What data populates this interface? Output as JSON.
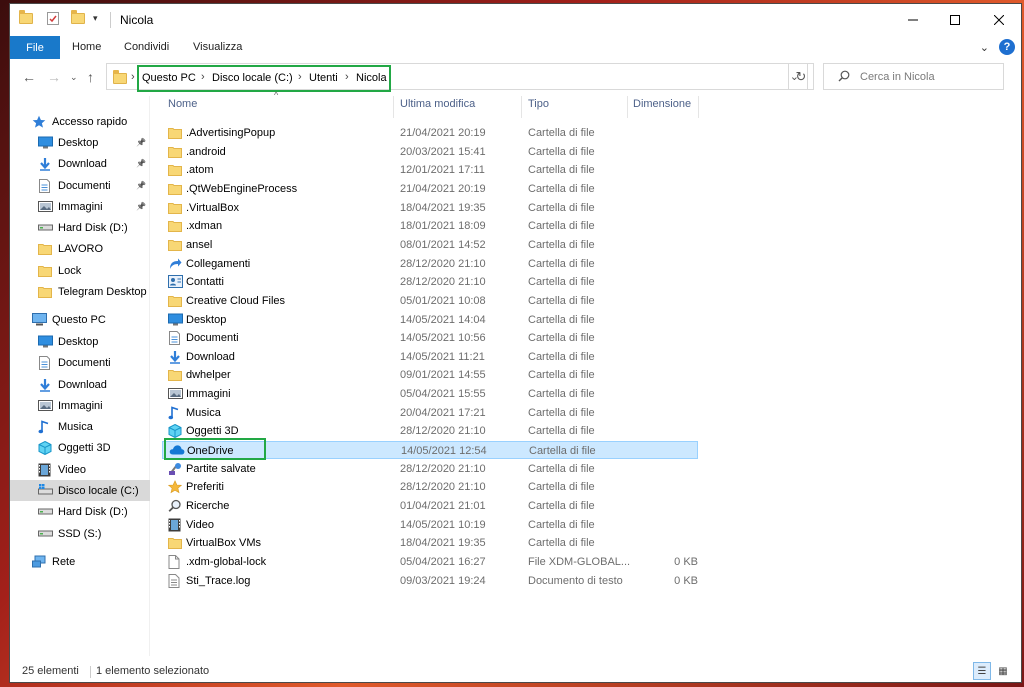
{
  "window": {
    "title": "Nicola"
  },
  "ribbon": {
    "tabs": [
      "File",
      "Home",
      "Condividi",
      "Visualizza"
    ]
  },
  "address": {
    "crumbs": [
      "Questo PC",
      "Disco locale (C:)",
      "Utenti",
      "Nicola"
    ],
    "search_placeholder": "Cerca in Nicola"
  },
  "sidebar": {
    "items": [
      {
        "label": "Accesso rapido",
        "icon": "star-icon",
        "level": 0
      },
      {
        "label": "Desktop",
        "icon": "desktop-icon",
        "level": 1,
        "pinned": true
      },
      {
        "label": "Download",
        "icon": "download-icon",
        "level": 1,
        "pinned": true
      },
      {
        "label": "Documenti",
        "icon": "document-icon",
        "level": 1,
        "pinned": true
      },
      {
        "label": "Immagini",
        "icon": "image-icon",
        "level": 1,
        "pinned": true
      },
      {
        "label": "Hard Disk (D:)",
        "icon": "drive-icon",
        "level": 1
      },
      {
        "label": "LAVORO",
        "icon": "folder-icon",
        "level": 1
      },
      {
        "label": "Lock",
        "icon": "folder-icon",
        "level": 1
      },
      {
        "label": "Telegram Desktop",
        "icon": "folder-icon",
        "level": 1
      },
      {
        "label": "Questo PC",
        "icon": "computer-icon",
        "level": 0
      },
      {
        "label": "Desktop",
        "icon": "desktop-icon",
        "level": 1
      },
      {
        "label": "Documenti",
        "icon": "document-icon",
        "level": 1
      },
      {
        "label": "Download",
        "icon": "download-icon",
        "level": 1
      },
      {
        "label": "Immagini",
        "icon": "image-icon",
        "level": 1
      },
      {
        "label": "Musica",
        "icon": "music-icon",
        "level": 1
      },
      {
        "label": "Oggetti 3D",
        "icon": "cube-icon",
        "level": 1
      },
      {
        "label": "Video",
        "icon": "video-icon",
        "level": 1
      },
      {
        "label": "Disco locale (C:)",
        "icon": "windows-drive-icon",
        "level": 1,
        "selected": true
      },
      {
        "label": "Hard Disk (D:)",
        "icon": "drive-icon",
        "level": 1
      },
      {
        "label": "SSD  (S:)",
        "icon": "drive-icon",
        "level": 1
      },
      {
        "label": "Rete",
        "icon": "network-icon",
        "level": 0
      }
    ]
  },
  "columns": {
    "name": "Nome",
    "date": "Ultima modifica",
    "type": "Tipo",
    "size": "Dimensione"
  },
  "files": [
    {
      "name": ".AdvertisingPopup",
      "date": "21/04/2021 20:19",
      "type": "Cartella di file",
      "size": "",
      "icon": "folder-icon"
    },
    {
      "name": ".android",
      "date": "20/03/2021 15:41",
      "type": "Cartella di file",
      "size": "",
      "icon": "folder-icon"
    },
    {
      "name": ".atom",
      "date": "12/01/2021 17:11",
      "type": "Cartella di file",
      "size": "",
      "icon": "folder-icon"
    },
    {
      "name": ".QtWebEngineProcess",
      "date": "21/04/2021 20:19",
      "type": "Cartella di file",
      "size": "",
      "icon": "folder-icon"
    },
    {
      "name": ".VirtualBox",
      "date": "18/04/2021 19:35",
      "type": "Cartella di file",
      "size": "",
      "icon": "folder-icon"
    },
    {
      "name": ".xdman",
      "date": "18/01/2021 18:09",
      "type": "Cartella di file",
      "size": "",
      "icon": "folder-icon"
    },
    {
      "name": "ansel",
      "date": "08/01/2021 14:52",
      "type": "Cartella di file",
      "size": "",
      "icon": "folder-icon"
    },
    {
      "name": "Collegamenti",
      "date": "28/12/2020 21:10",
      "type": "Cartella di file",
      "size": "",
      "icon": "link-icon"
    },
    {
      "name": "Contatti",
      "date": "28/12/2020 21:10",
      "type": "Cartella di file",
      "size": "",
      "icon": "contacts-icon"
    },
    {
      "name": "Creative Cloud Files",
      "date": "05/01/2021 10:08",
      "type": "Cartella di file",
      "size": "",
      "icon": "folder-icon"
    },
    {
      "name": "Desktop",
      "date": "14/05/2021 14:04",
      "type": "Cartella di file",
      "size": "",
      "icon": "desktop-icon"
    },
    {
      "name": "Documenti",
      "date": "14/05/2021 10:56",
      "type": "Cartella di file",
      "size": "",
      "icon": "document-icon"
    },
    {
      "name": "Download",
      "date": "14/05/2021 11:21",
      "type": "Cartella di file",
      "size": "",
      "icon": "download-icon"
    },
    {
      "name": "dwhelper",
      "date": "09/01/2021 14:55",
      "type": "Cartella di file",
      "size": "",
      "icon": "folder-icon"
    },
    {
      "name": "Immagini",
      "date": "05/04/2021 15:55",
      "type": "Cartella di file",
      "size": "",
      "icon": "image-icon"
    },
    {
      "name": "Musica",
      "date": "20/04/2021 17:21",
      "type": "Cartella di file",
      "size": "",
      "icon": "music-icon"
    },
    {
      "name": "Oggetti 3D",
      "date": "28/12/2020 21:10",
      "type": "Cartella di file",
      "size": "",
      "icon": "cube-icon"
    },
    {
      "name": "OneDrive",
      "date": "14/05/2021 12:54",
      "type": "Cartella di file",
      "size": "",
      "icon": "cloud-icon",
      "selected": true
    },
    {
      "name": "Partite salvate",
      "date": "28/12/2020 21:10",
      "type": "Cartella di file",
      "size": "",
      "icon": "game-icon"
    },
    {
      "name": "Preferiti",
      "date": "28/12/2020 21:10",
      "type": "Cartella di file",
      "size": "",
      "icon": "star-icon"
    },
    {
      "name": "Ricerche",
      "date": "01/04/2021 21:01",
      "type": "Cartella di file",
      "size": "",
      "icon": "search-icon"
    },
    {
      "name": "Video",
      "date": "14/05/2021 10:19",
      "type": "Cartella di file",
      "size": "",
      "icon": "video-icon"
    },
    {
      "name": "VirtualBox VMs",
      "date": "18/04/2021 19:35",
      "type": "Cartella di file",
      "size": "",
      "icon": "folder-icon"
    },
    {
      "name": ".xdm-global-lock",
      "date": "05/04/2021 16:27",
      "type": "File XDM-GLOBAL...",
      "size": "0 KB",
      "icon": "file-icon"
    },
    {
      "name": "Sti_Trace.log",
      "date": "09/03/2021 19:24",
      "type": "Documento di testo",
      "size": "0 KB",
      "icon": "text-file-icon"
    }
  ],
  "status": {
    "count": "25 elementi",
    "selection": "1 elemento selezionato"
  }
}
